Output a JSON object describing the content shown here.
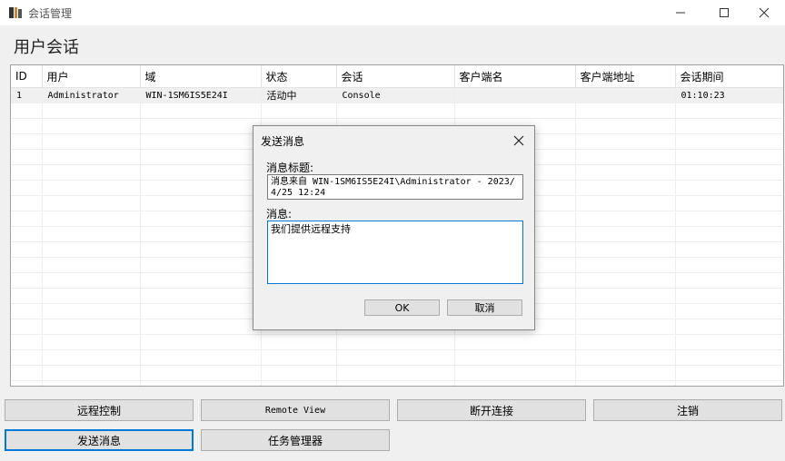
{
  "window": {
    "title": "会话管理"
  },
  "page_title": "用户会话",
  "columns": [
    "ID",
    "用户",
    "域",
    "状态",
    "会话",
    "客户端名",
    "客户端地址",
    "会话期间"
  ],
  "rows": [
    [
      "1",
      "Administrator",
      "WIN-1SM6IS5E24I",
      "活动中",
      "Console",
      "",
      "",
      "01:10:23"
    ]
  ],
  "buttons": {
    "remote_control": "远程控制",
    "remote_view": "Remote View",
    "disconnect": "断开连接",
    "logoff": "注销",
    "send_message": "发送消息",
    "task_manager": "任务管理器"
  },
  "dialog": {
    "title": "发送消息",
    "subject_label": "消息标题:",
    "subject_value": "消息来自 WIN-1SM6IS5E24I\\Administrator - 2023/4/25 12:24",
    "message_label": "消息:",
    "message_value": "我们提供远程支持",
    "ok": "OK",
    "cancel": "取消"
  },
  "colors": {
    "accent": "#0078d7",
    "button_bg": "#e1e1e1",
    "window_bg": "#f0f0f0"
  }
}
